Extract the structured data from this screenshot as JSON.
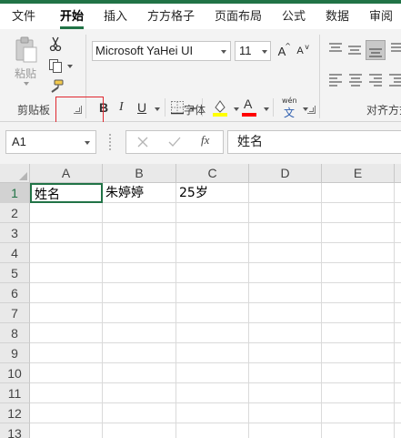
{
  "tabs": [
    {
      "label": "文件"
    },
    {
      "label": "开始"
    },
    {
      "label": "插入"
    },
    {
      "label": "方方格子"
    },
    {
      "label": "页面布局"
    },
    {
      "label": "公式"
    },
    {
      "label": "数据"
    },
    {
      "label": "审阅"
    }
  ],
  "ribbon": {
    "clipboard": {
      "paste_label": "粘贴",
      "group_label": "剪贴板"
    },
    "font": {
      "font_name": "Microsoft YaHei UI",
      "font_size": "11",
      "bold_label": "B",
      "italic_label": "I",
      "underline_label": "U",
      "grow_label": "A",
      "shrink_label": "A",
      "color_letter": "A",
      "phonetic_top": "wén",
      "phonetic_bottom": "文",
      "group_label": "字体",
      "fill_color": "#ffff00",
      "font_color": "#ff0000"
    },
    "alignment": {
      "group_label": "对齐方式"
    }
  },
  "formula_bar": {
    "name_box": "A1",
    "fx_label": "fx",
    "content": "姓名"
  },
  "sheet": {
    "columns": [
      "A",
      "B",
      "C",
      "D",
      "E"
    ],
    "rows": [
      "1",
      "2",
      "3",
      "4",
      "5",
      "6",
      "7",
      "8",
      "9",
      "10",
      "11",
      "12",
      "13"
    ],
    "cells": {
      "A1": "姓名",
      "B1": "朱婷婷",
      "C1": "25岁"
    }
  },
  "accent_color": "#217346"
}
